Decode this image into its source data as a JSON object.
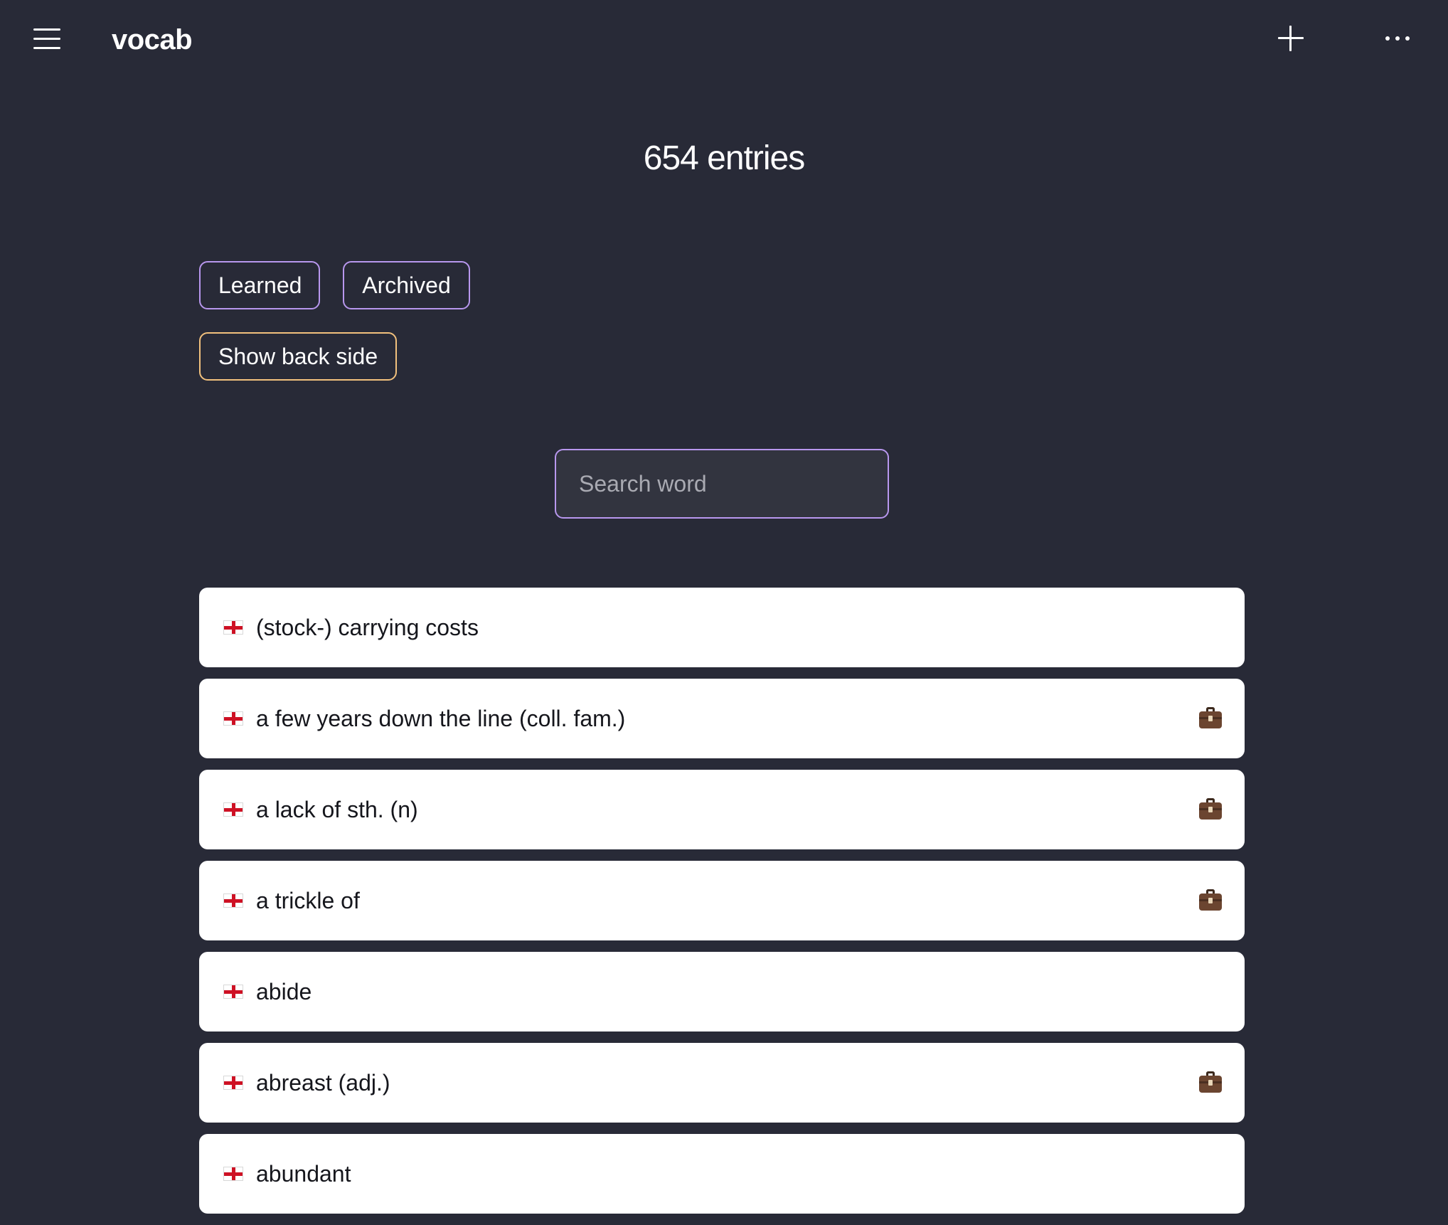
{
  "header": {
    "menu_icon": "hamburger-menu-icon",
    "title": "vocab",
    "add_icon": "plus-icon",
    "more_icon": "more-horizontal-icon"
  },
  "summary": {
    "entries_label": "654 entries"
  },
  "filters": {
    "learned": "Learned",
    "archived": "Archived",
    "show_back_side": "Show back side"
  },
  "search": {
    "placeholder": "Search word",
    "value": ""
  },
  "colors": {
    "background": "#282a37",
    "filter_border": "#b897ee",
    "back_side_border": "#f2c17d",
    "card_background": "#ffffff"
  },
  "entries": [
    {
      "word": "(stock-) carrying costs",
      "flag_icon": "england-flag-icon",
      "work_icon": ""
    },
    {
      "word": "a few years down the line (coll. fam.)",
      "flag_icon": "england-flag-icon",
      "work_icon": "briefcase-icon"
    },
    {
      "word": "a lack of sth. (n)",
      "flag_icon": "england-flag-icon",
      "work_icon": "briefcase-icon"
    },
    {
      "word": "a trickle of",
      "flag_icon": "england-flag-icon",
      "work_icon": "briefcase-icon"
    },
    {
      "word": "abide",
      "flag_icon": "england-flag-icon",
      "work_icon": ""
    },
    {
      "word": "abreast (adj.)",
      "flag_icon": "england-flag-icon",
      "work_icon": "briefcase-icon"
    },
    {
      "word": "abundant",
      "flag_icon": "england-flag-icon",
      "work_icon": ""
    }
  ]
}
